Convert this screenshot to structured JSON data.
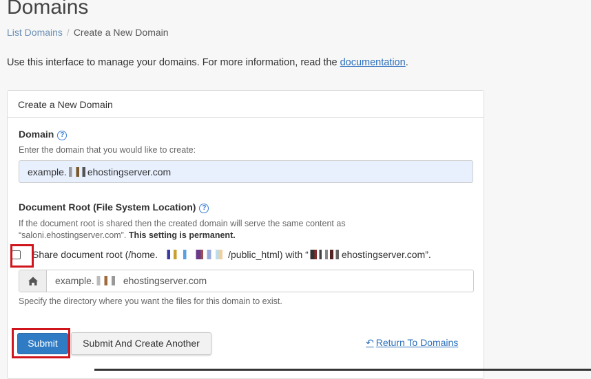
{
  "page": {
    "title": "Domains",
    "breadcrumb": {
      "list_link": "List Domains",
      "separator": "/",
      "current": "Create a New Domain"
    },
    "intro": {
      "text": "Use this interface to manage your domains. For more information, read the ",
      "link": "documentation",
      "end": "."
    }
  },
  "panel": {
    "heading": "Create a New Domain",
    "domain": {
      "label": "Domain",
      "help": "Enter the domain that you would like to create:",
      "value_prefix": "example.",
      "value_suffix": "ehostingserver.com"
    },
    "docroot": {
      "label": "Document Root (File System Location)",
      "help_line1": "If the document root is shared then the created domain will serve the same content as",
      "help_line2": "“saloni.ehostingserver.com”.",
      "help_bold": "This setting is permanent.",
      "share_prefix": "Share document root (/home.",
      "share_middle": "/public_html) with “",
      "share_suffix": "ehostingserver.com”.",
      "input_prefix": "example.",
      "input_suffix": "ehostingserver.com",
      "dir_help": "Specify the directory where you want the files for this domain to exist."
    },
    "actions": {
      "submit": "Submit",
      "submit_another": "Submit And Create Another",
      "return": "Return To Domains"
    }
  },
  "icons": {
    "help": "question-circle-icon",
    "home": "home-icon",
    "return": "reply-arrow-icon"
  },
  "colors": {
    "primary": "#2f7cc4",
    "link": "#2a6ebb",
    "highlight": "#d0141c"
  }
}
